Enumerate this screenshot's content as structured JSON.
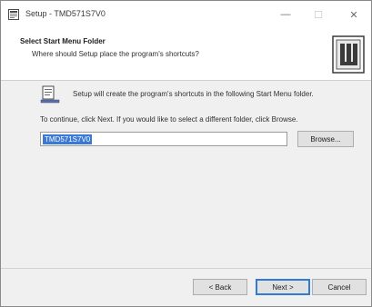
{
  "window": {
    "title": "Setup - TMD571S7V0",
    "minimize_glyph": "—",
    "maximize_glyph": "☐",
    "close_glyph": "✕"
  },
  "header": {
    "title": "Select Start Menu Folder",
    "subtitle": "Where should Setup place the program's shortcuts?"
  },
  "body": {
    "info_text": "Setup will create the program's shortcuts in the following Start Menu folder.",
    "instruction_text": "To continue, click Next. If you would like to select a different folder, click Browse.",
    "folder_value": "TMD571S7V0",
    "browse_label": "Browse..."
  },
  "footer": {
    "back_label": "< Back",
    "next_label": "Next >",
    "cancel_label": "Cancel"
  },
  "icons": {
    "app": "setup-icon",
    "folder": "start-menu-folder-icon",
    "logo": "installer-logo-icon"
  },
  "colors": {
    "selection": "#3a79d6",
    "default_button_border": "#2f7bd6"
  }
}
